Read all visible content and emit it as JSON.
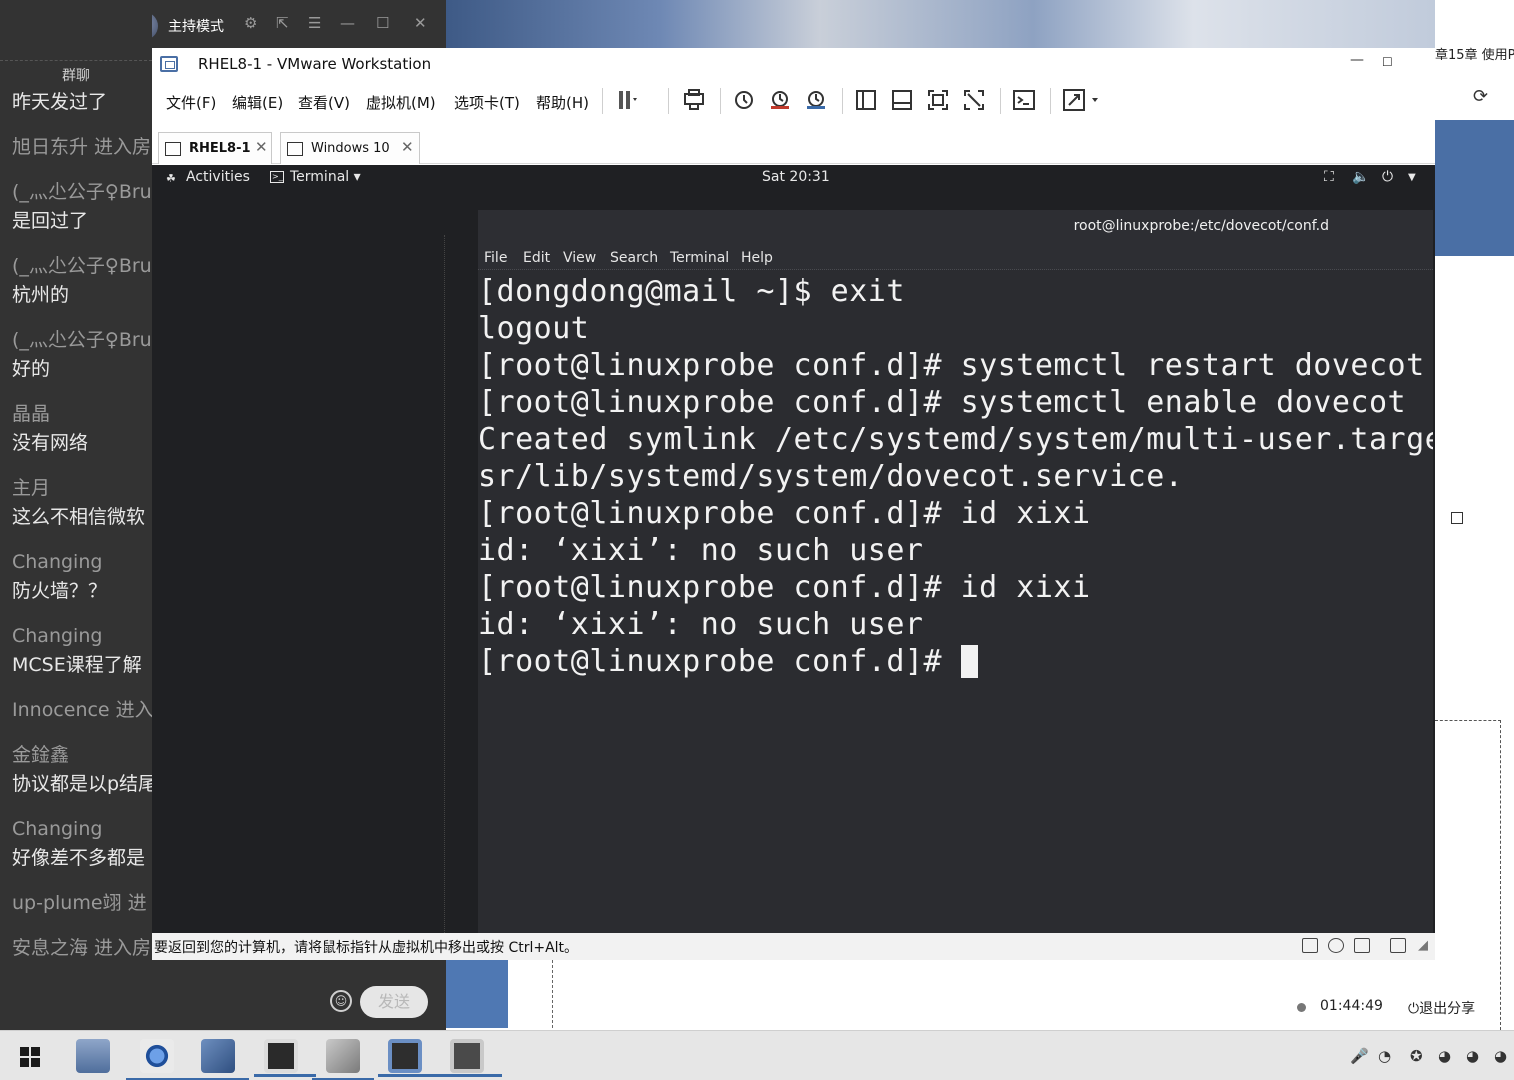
{
  "chat": {
    "host_mode_label": "主持模式",
    "group_tab": "群聊",
    "messages": [
      {
        "kind": "text",
        "value": "昨天发过了"
      },
      {
        "kind": "sys",
        "value": "旭日东升 进入房"
      },
      {
        "kind": "name",
        "value": "(_灬尐公子♀Bru"
      },
      {
        "kind": "text",
        "value": "是回过了"
      },
      {
        "kind": "name",
        "value": "(_灬尐公子♀Bru"
      },
      {
        "kind": "text",
        "value": "杭州的"
      },
      {
        "kind": "name",
        "value": "(_灬尐公子♀Bru"
      },
      {
        "kind": "text",
        "value": "好的"
      },
      {
        "kind": "name",
        "value": "晶晶"
      },
      {
        "kind": "text",
        "value": "没有网络"
      },
      {
        "kind": "name",
        "value": "主月"
      },
      {
        "kind": "text",
        "value": "这么不相信微软"
      },
      {
        "kind": "name",
        "value": "Changing"
      },
      {
        "kind": "text",
        "value": "防火墙？？"
      },
      {
        "kind": "name",
        "value": "Changing"
      },
      {
        "kind": "text",
        "value": "MCSE课程了解"
      },
      {
        "kind": "sys",
        "value": "Innocence 进入"
      },
      {
        "kind": "name",
        "value": "金鍂鑫"
      },
      {
        "kind": "text",
        "value": "协议都是以p结尾"
      },
      {
        "kind": "name",
        "value": "Changing"
      },
      {
        "kind": "text",
        "value": "好像差不多都是"
      },
      {
        "kind": "sys",
        "value": "up-plume翊 进"
      },
      {
        "kind": "sys",
        "value": "安息之海 进入房"
      }
    ],
    "emoji_glyph": "☺",
    "send_label": "发送"
  },
  "right_panel": {
    "chapter_text": "章15章 使用P",
    "recording_time": "01:44:49",
    "exit_share_label": "退出分享"
  },
  "vmware": {
    "title": "RHEL8-1 - VMware Workstation",
    "menu": [
      "文件(F)",
      "编辑(E)",
      "查看(V)",
      "虚拟机(M)",
      "选项卡(T)",
      "帮助(H)"
    ],
    "tabs": [
      {
        "label": "RHEL8-1",
        "active": true
      },
      {
        "label": "Windows 10",
        "active": false
      }
    ],
    "status_hint": "要返回到您的计算机，请将鼠标指针从虚拟机中移出或按 Ctrl+Alt。"
  },
  "gnome": {
    "activities": "Activities",
    "app_menu": "Terminal ▾",
    "clock": "Sat 20:31"
  },
  "terminal": {
    "title": "root@linuxprobe:/etc/dovecot/conf.d",
    "menu": [
      "File",
      "Edit",
      "View",
      "Search",
      "Terminal",
      "Help"
    ],
    "lines": [
      "[dongdong@mail ~]$ exit",
      "logout",
      "[root@linuxprobe conf.d]# systemctl restart dovecot",
      "[root@linuxprobe conf.d]# systemctl enable dovecot",
      "Created symlink /etc/systemd/system/multi-user.target",
      "sr/lib/systemd/system/dovecot.service.",
      "[root@linuxprobe conf.d]# id xixi",
      "id: ‘xixi’: no such user",
      "[root@linuxprobe conf.d]# id xixi",
      "id: ‘xixi’: no such user"
    ],
    "prompt": "[root@linuxprobe conf.d]# "
  },
  "colors": {
    "chat_bg": "#333333",
    "terminal_bg": "#2b2c30",
    "accent_blue": "#4a6fa5"
  }
}
